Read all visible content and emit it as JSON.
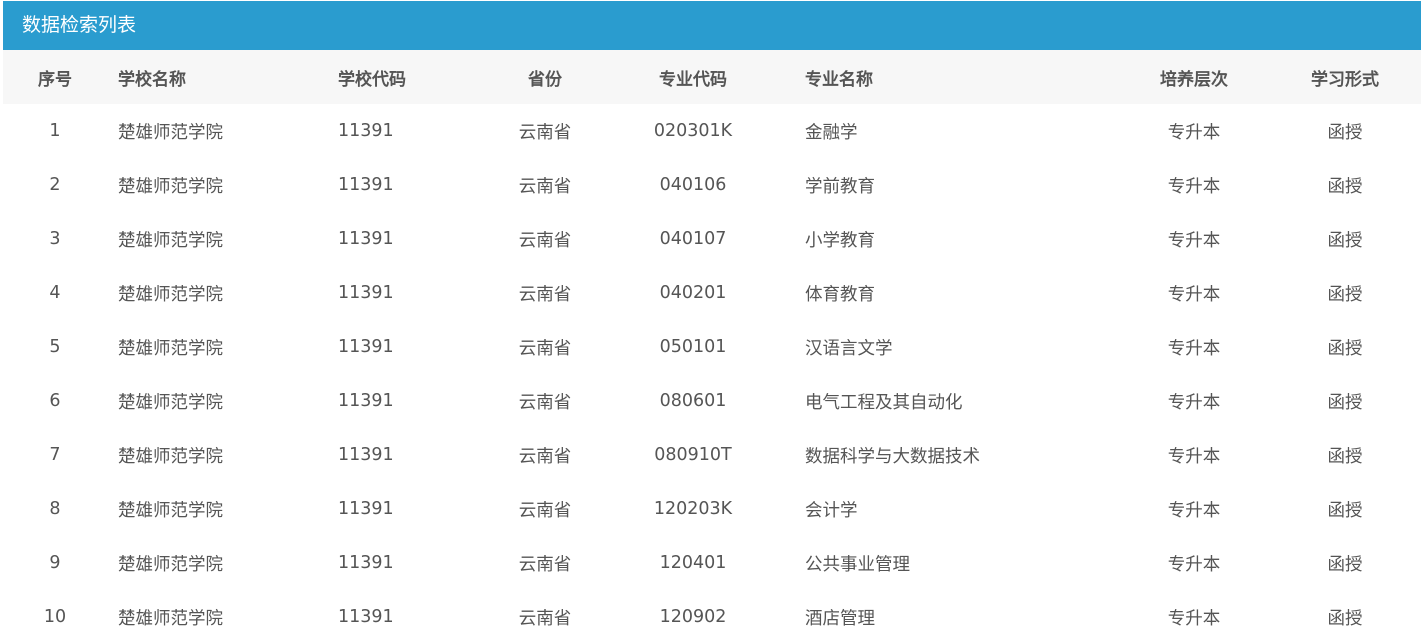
{
  "panel": {
    "title": "数据检索列表"
  },
  "colors": {
    "header_bg": "#2a9ccf",
    "thead_bg": "#f7f7f7",
    "text": "#555555"
  },
  "table": {
    "columns": [
      "序号",
      "学校名称",
      "学校代码",
      "省份",
      "专业代码",
      "专业名称",
      "培养层次",
      "学习形式"
    ],
    "rows": [
      [
        "1",
        "楚雄师范学院",
        "11391",
        "云南省",
        "020301K",
        "金融学",
        "专升本",
        "函授"
      ],
      [
        "2",
        "楚雄师范学院",
        "11391",
        "云南省",
        "040106",
        "学前教育",
        "专升本",
        "函授"
      ],
      [
        "3",
        "楚雄师范学院",
        "11391",
        "云南省",
        "040107",
        "小学教育",
        "专升本",
        "函授"
      ],
      [
        "4",
        "楚雄师范学院",
        "11391",
        "云南省",
        "040201",
        "体育教育",
        "专升本",
        "函授"
      ],
      [
        "5",
        "楚雄师范学院",
        "11391",
        "云南省",
        "050101",
        "汉语言文学",
        "专升本",
        "函授"
      ],
      [
        "6",
        "楚雄师范学院",
        "11391",
        "云南省",
        "080601",
        "电气工程及其自动化",
        "专升本",
        "函授"
      ],
      [
        "7",
        "楚雄师范学院",
        "11391",
        "云南省",
        "080910T",
        "数据科学与大数据技术",
        "专升本",
        "函授"
      ],
      [
        "8",
        "楚雄师范学院",
        "11391",
        "云南省",
        "120203K",
        "会计学",
        "专升本",
        "函授"
      ],
      [
        "9",
        "楚雄师范学院",
        "11391",
        "云南省",
        "120401",
        "公共事业管理",
        "专升本",
        "函授"
      ],
      [
        "10",
        "楚雄师范学院",
        "11391",
        "云南省",
        "120902",
        "酒店管理",
        "专升本",
        "函授"
      ]
    ]
  }
}
